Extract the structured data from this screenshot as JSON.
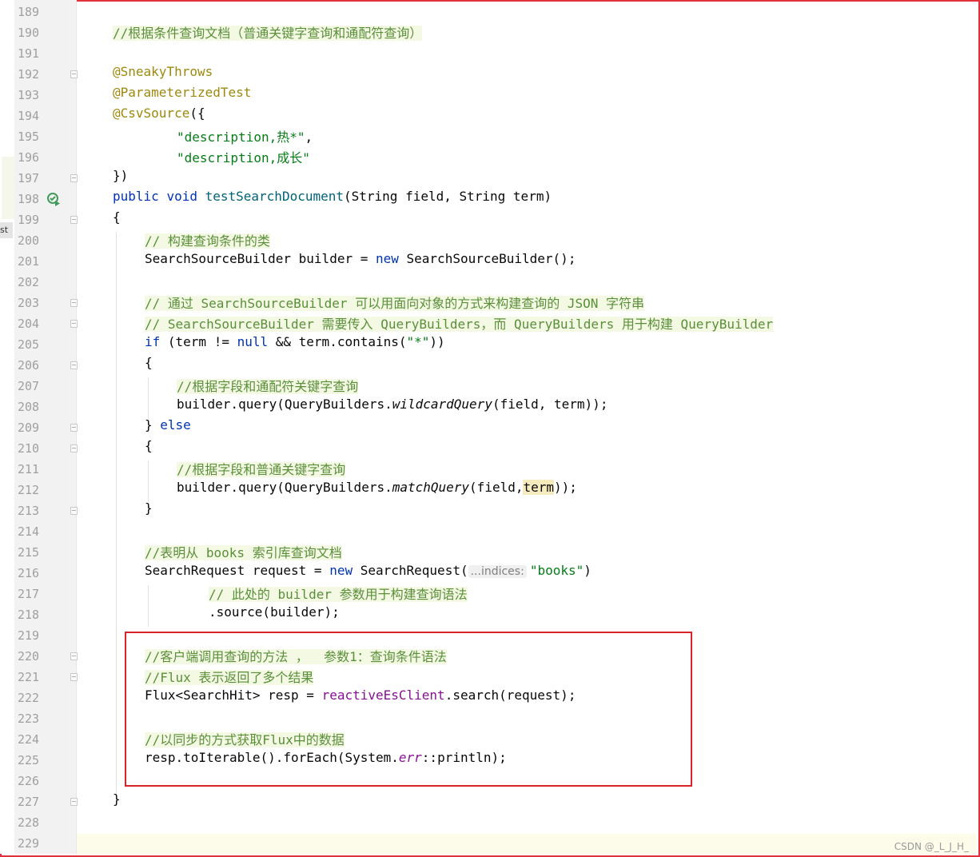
{
  "sidebar": {
    "tab_label": "st"
  },
  "editor": {
    "lines": [
      {
        "n": "189"
      },
      {
        "n": "190"
      },
      {
        "n": "191"
      },
      {
        "n": "192"
      },
      {
        "n": "193"
      },
      {
        "n": "194"
      },
      {
        "n": "195"
      },
      {
        "n": "196"
      },
      {
        "n": "197"
      },
      {
        "n": "198"
      },
      {
        "n": "199"
      },
      {
        "n": "200"
      },
      {
        "n": "201"
      },
      {
        "n": "202"
      },
      {
        "n": "203"
      },
      {
        "n": "204"
      },
      {
        "n": "205"
      },
      {
        "n": "206"
      },
      {
        "n": "207"
      },
      {
        "n": "208"
      },
      {
        "n": "209"
      },
      {
        "n": "210"
      },
      {
        "n": "211"
      },
      {
        "n": "212"
      },
      {
        "n": "213"
      },
      {
        "n": "214"
      },
      {
        "n": "215"
      },
      {
        "n": "216"
      },
      {
        "n": "217"
      },
      {
        "n": "218"
      },
      {
        "n": "219"
      },
      {
        "n": "220"
      },
      {
        "n": "221"
      },
      {
        "n": "222"
      },
      {
        "n": "223"
      },
      {
        "n": "224"
      },
      {
        "n": "225"
      },
      {
        "n": "226"
      },
      {
        "n": "227"
      },
      {
        "n": "228"
      },
      {
        "n": "229"
      }
    ],
    "code": {
      "l190": "//根据条件查询文档（普通关键字查询和通配符查询）",
      "l192": "@SneakyThrows",
      "l193": "@ParameterizedTest",
      "l194_ann": "@CsvSource",
      "l194_rest": "({",
      "l195_str": "\"description,热*\"",
      "l195_rest": ",",
      "l196_str": "\"description,成长\"",
      "l197": "})",
      "l198_public": "public",
      "l198_void": "void",
      "l198_fn": "testSearchDocument",
      "l198_rest": "(String field, String term)",
      "l199": "{",
      "l200": "// 构建查询条件的类",
      "l201_a": "SearchSourceBuilder builder = ",
      "l201_new": "new",
      "l201_b": " SearchSourceBuilder();",
      "l203": "// 通过 SearchSourceBuilder 可以用面向对象的方式来构建查询的 JSON 字符串",
      "l204": "// SearchSourceBuilder 需要传入 QueryBuilders，而 QueryBuilders 用于构建 QueryBuilder",
      "l205_if": "if",
      "l205_a": " (term != ",
      "l205_null": "null",
      "l205_b": " && term.contains(",
      "l205_str": "\"*\"",
      "l205_c": "))",
      "l206": "{",
      "l207": "//根据字段和通配符关键字查询",
      "l208_a": "builder.query(QueryBuilders.",
      "l208_it": "wildcardQuery",
      "l208_b": "(field, term));",
      "l209_a": "} ",
      "l209_else": "else",
      "l210": "{",
      "l211": "//根据字段和普通关键字查询",
      "l212_a": "builder.query(QueryBuilders.",
      "l212_it": "matchQuery",
      "l212_b": "(field,",
      "l212_term": "term",
      "l212_c": "));",
      "l213": "}",
      "l215": "//表明从 books 索引库查询文档",
      "l216_a": "SearchRequest request = ",
      "l216_new": "new",
      "l216_b": " SearchRequest(",
      "l216_hint": "...indices:",
      "l216_str": "\"books\"",
      "l216_c": ")",
      "l217": "// 此处的 builder 参数用于构建查询语法",
      "l218": ".source(builder);",
      "l220": "//客户端调用查询的方法 ，  参数1：查询条件语法",
      "l221": "//Flux 表示返回了多个结果",
      "l222_a": "Flux<SearchHit> resp = ",
      "l222_field": "reactiveEsClient",
      "l222_b": ".search(request);",
      "l224": "//以同步的方式获取Flux中的数据",
      "l225_a": "resp.toIterable().forEach(System.",
      "l225_err": "err",
      "l225_b": "::println);",
      "l227": "}"
    }
  },
  "watermark": "CSDN @_L_J_H_",
  "colors": {
    "comment": "#5a8f3a",
    "annotation": "#9e880d",
    "keyword": "#0033b3",
    "string": "#067d17",
    "field": "#871094",
    "highlight_box": "#d9232b"
  }
}
